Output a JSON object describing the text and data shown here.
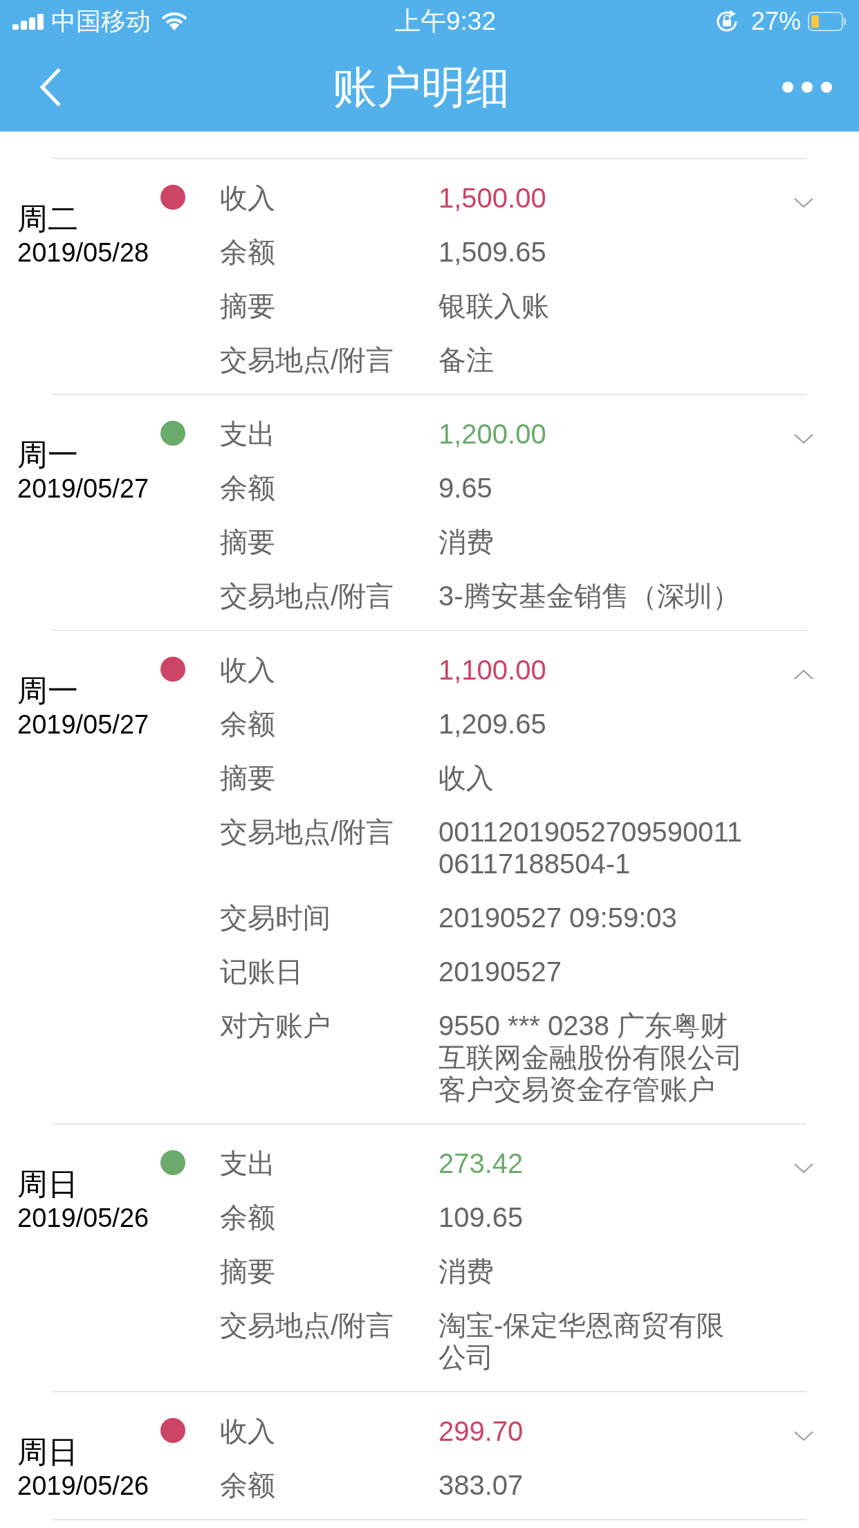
{
  "status_bar": {
    "carrier": "中国移动",
    "time": "上午9:32",
    "battery": "27%"
  },
  "header": {
    "title": "账户明细"
  },
  "entries": [
    {
      "day": "周二",
      "date": "2019/05/28",
      "kind": "income",
      "expanded": false,
      "fields": [
        {
          "label": "收入",
          "value": "1,500.00"
        },
        {
          "label": "余额",
          "value": "1,509.65"
        },
        {
          "label": "摘要",
          "value": "银联入账"
        },
        {
          "label": "交易地点/附言",
          "value": "备注"
        }
      ]
    },
    {
      "day": "周一",
      "date": "2019/05/27",
      "kind": "expense",
      "expanded": false,
      "fields": [
        {
          "label": "支出",
          "value": "1,200.00"
        },
        {
          "label": "余额",
          "value": "9.65"
        },
        {
          "label": "摘要",
          "value": "消费"
        },
        {
          "label": "交易地点/附言",
          "value": "3-腾安基金销售（深圳）"
        }
      ]
    },
    {
      "day": "周一",
      "date": "2019/05/27",
      "kind": "income",
      "expanded": true,
      "fields": [
        {
          "label": "收入",
          "value": "1,100.00"
        },
        {
          "label": "余额",
          "value": "1,209.65"
        },
        {
          "label": "摘要",
          "value": "收入"
        },
        {
          "label": "交易地点/附言",
          "value": "0011201905270959001106117188504-1"
        },
        {
          "label": "交易时间",
          "value": "20190527 09:59:03"
        },
        {
          "label": "记账日",
          "value": "20190527"
        },
        {
          "label": "对方账户",
          "value": "9550 *** 0238 广东粤财互联网金融股份有限公司客户交易资金存管账户"
        }
      ]
    },
    {
      "day": "周日",
      "date": "2019/05/26",
      "kind": "expense",
      "expanded": false,
      "fields": [
        {
          "label": "支出",
          "value": "273.42"
        },
        {
          "label": "余额",
          "value": "109.65"
        },
        {
          "label": "摘要",
          "value": "消费"
        },
        {
          "label": "交易地点/附言",
          "value": "淘宝-保定华恩商贸有限公司"
        }
      ]
    },
    {
      "day": "周日",
      "date": "2019/05/26",
      "kind": "income",
      "expanded": false,
      "fields": [
        {
          "label": "收入",
          "value": "299.70"
        },
        {
          "label": "余额",
          "value": "383.07"
        }
      ]
    }
  ]
}
